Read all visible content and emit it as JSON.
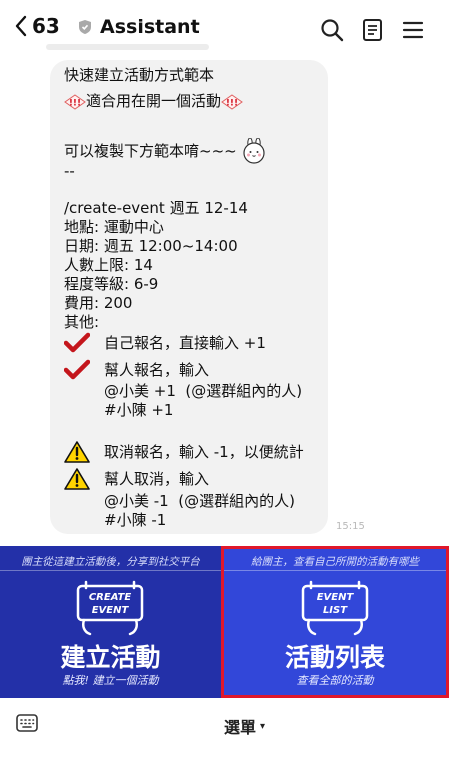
{
  "header": {
    "back_count": "63",
    "title": "Assistant"
  },
  "message": {
    "lines_top": [
      "快速建立活動方式範本"
    ],
    "line_badge": "適合用在開一個活動",
    "line_copy": "可以複製下方範本唷~~~",
    "line_sep": "--",
    "template_lines": [
      "/create-event 週五 12-14",
      "地點: 運動中心",
      "日期: 週五 12:00~14:00",
      "人數上限: 14",
      "程度等級: 6-9",
      "費用: 200",
      "其他:"
    ],
    "check1": "自己報名，直接輸入 +1",
    "check2": "幫人報名，輸入",
    "check2_sub1": "@小美 +1  (@選群組內的人)",
    "check2_sub2": "#小陳 +1",
    "warn1": "取消報名，輸入 -1，以便統計",
    "warn2": "幫人取消，輸入",
    "warn2_sub1": "@小美 -1  (@選群組內的人)",
    "warn2_sub2": "#小陳 -1",
    "timestamp": "15:15"
  },
  "richmenu": {
    "left": {
      "top_text": "團主從這建立活動後，分享到社交平台",
      "sign_text_1": "CREATE",
      "sign_text_2": "EVENT",
      "big": "建立活動",
      "small": "點我! 建立一個活動",
      "color": "#2330a8"
    },
    "right": {
      "top_text": "給團主，查看自己所開的活動有哪些",
      "sign_text_1": "EVENT",
      "sign_text_2": "LIST",
      "big": "活動列表",
      "small": "查看全部的活動",
      "color": "#3247d9",
      "highlight": "#e0182b"
    }
  },
  "bottom": {
    "menu_label": "選單",
    "caret": "▾"
  }
}
